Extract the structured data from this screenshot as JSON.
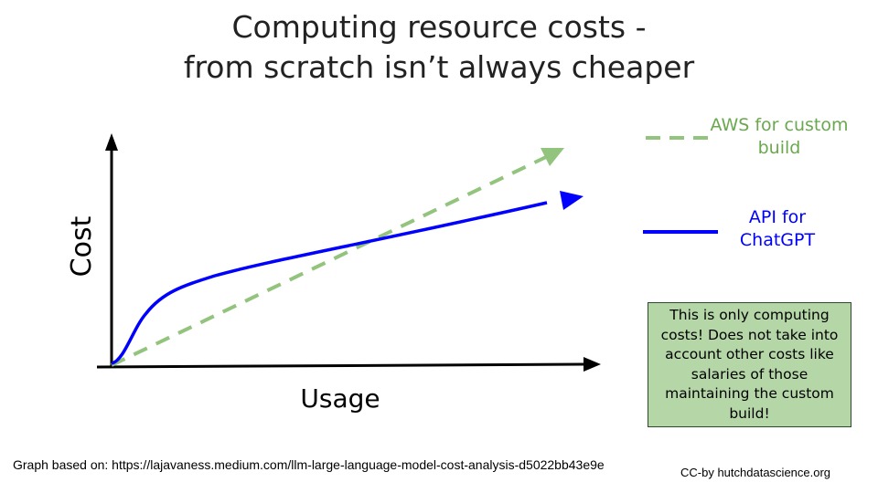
{
  "title": {
    "line1": "Computing resource costs -",
    "line2": "from scratch isn’t always cheaper"
  },
  "axes": {
    "y_label": "Cost",
    "x_label": "Usage"
  },
  "series": [
    {
      "id": "aws",
      "name": "AWS for custom build",
      "label_line1": "AWS for custom",
      "label_line2": "build",
      "color": "#93c47d",
      "style": "dashed",
      "shape": "linear"
    },
    {
      "id": "api",
      "name": "API for ChatGPT",
      "label_line1": "API for",
      "label_line2": "ChatGPT",
      "color": "#0000ff",
      "style": "solid",
      "shape": "concave"
    }
  ],
  "note": {
    "text": "This is only computing costs! Does not take into account other costs like salaries of those maintaining the custom build!",
    "background": "#b6d7a8"
  },
  "source": "Graph based on: https://lajavaness.medium.com/llm-large-language-model-cost-analysis-d5022bb43e9e",
  "credit": "CC-by hutchdatascience.org"
}
